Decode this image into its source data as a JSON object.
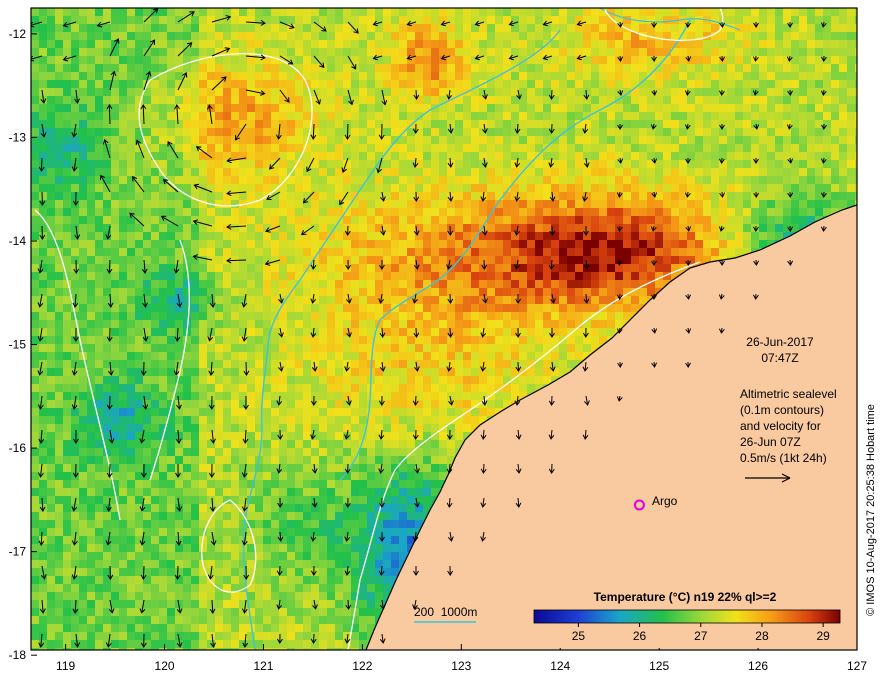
{
  "map": {
    "date": "26-Jun-2017",
    "time": "07:47Z",
    "lon_ticks": [
      "119",
      "120",
      "121",
      "122",
      "123",
      "124",
      "125",
      "126",
      "127"
    ],
    "lat_ticks": [
      "-12",
      "-13",
      "-14",
      "-15",
      "-16",
      "-17",
      "-18"
    ],
    "lon_range": [
      118.65,
      127.0
    ],
    "lat_range": [
      -17.95,
      -11.75
    ]
  },
  "info": {
    "lines": [
      "Altimetric sealevel",
      "(0.1m contours)",
      "and velocity for",
      "26-Jun 07Z",
      "0.5m/s (1kt 24h)"
    ]
  },
  "argo": {
    "label": "Argo",
    "lon": 124.8,
    "lat": -16.55,
    "color": "#e000e0"
  },
  "bathymetry_label": "200  1000m",
  "colorbar": {
    "title": "Temperature (°C) n19 22% ql>=2",
    "ticks": [
      "25",
      "26",
      "27",
      "28",
      "29"
    ]
  },
  "credit": "© IMOS 10-Aug-2017 20:25:38 Hobart time",
  "colors": {
    "land": "#f9c9a0",
    "contour_cyan": "#3fc3d8",
    "sst_low": "#0a0a96",
    "sst_high": "#7a0000"
  }
}
